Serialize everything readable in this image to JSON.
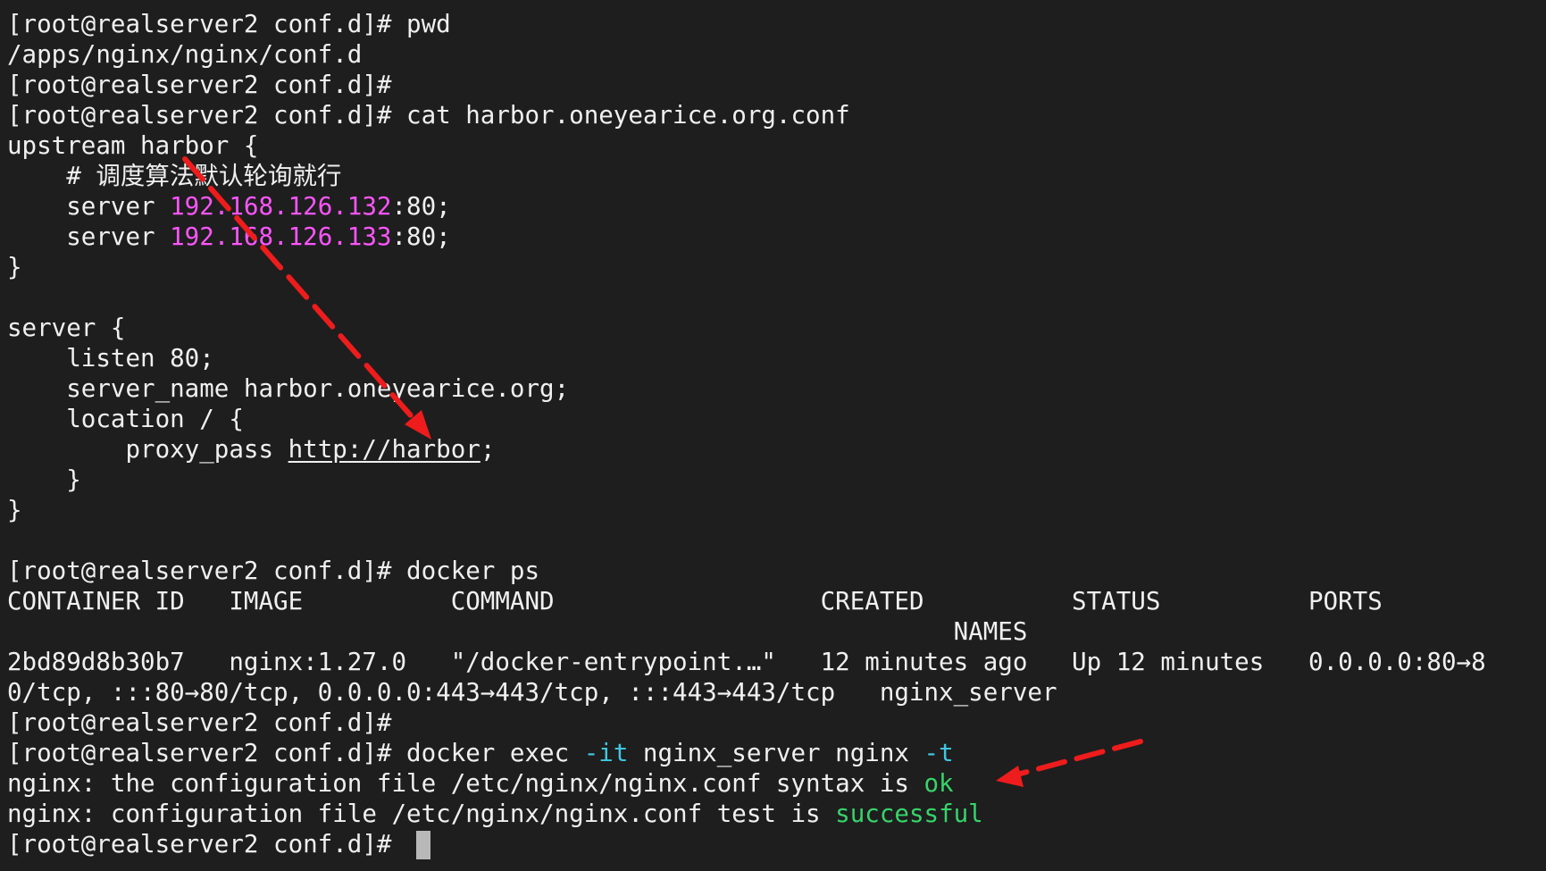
{
  "terminal": {
    "lines": [
      [
        {
          "t": "[root@realserver2 conf.d]# pwd"
        }
      ],
      [
        {
          "t": "/apps/nginx/nginx/conf.d"
        }
      ],
      [
        {
          "t": "[root@realserver2 conf.d]#"
        }
      ],
      [
        {
          "t": "[root@realserver2 conf.d]# cat harbor.oneyearice.org.conf"
        }
      ],
      [
        {
          "t": "upstream harbor {"
        }
      ],
      [
        {
          "t": "    # 调度算法默认轮询就行"
        }
      ],
      [
        {
          "t": "    server "
        },
        {
          "t": "192.168.126.132",
          "c": "ip"
        },
        {
          "t": ":80;"
        }
      ],
      [
        {
          "t": "    server "
        },
        {
          "t": "192.168.126.133",
          "c": "ip"
        },
        {
          "t": ":80;"
        }
      ],
      [
        {
          "t": "}"
        }
      ],
      [
        {
          "t": ""
        }
      ],
      [
        {
          "t": "server {"
        }
      ],
      [
        {
          "t": "    listen 80;"
        }
      ],
      [
        {
          "t": "    server_name harbor.oneyearice.org;"
        }
      ],
      [
        {
          "t": "    location / {"
        }
      ],
      [
        {
          "t": "        proxy_pass "
        },
        {
          "t": "http://harbor",
          "c": "link"
        },
        {
          "t": ";"
        }
      ],
      [
        {
          "t": "    }"
        }
      ],
      [
        {
          "t": "}"
        }
      ],
      [
        {
          "t": ""
        }
      ],
      [
        {
          "t": "[root@realserver2 conf.d]# docker ps"
        }
      ],
      [
        {
          "t": "CONTAINER ID   IMAGE          COMMAND                  CREATED          STATUS          PORTS"
        }
      ],
      [
        {
          "t": "                                                                NAMES"
        }
      ],
      [
        {
          "t": "2bd89d8b30b7   nginx:1.27.0   \"/docker-entrypoint.…\"   12 minutes ago   Up 12 minutes   0.0.0.0:80→8"
        }
      ],
      [
        {
          "t": "0/tcp, :::80→80/tcp, 0.0.0.0:443→443/tcp, :::443→443/tcp   nginx_server"
        }
      ],
      [
        {
          "t": "[root@realserver2 conf.d]#"
        }
      ],
      [
        {
          "t": "[root@realserver2 conf.d]# docker exec "
        },
        {
          "t": "-it",
          "c": "opt"
        },
        {
          "t": " nginx_server nginx "
        },
        {
          "t": "-t",
          "c": "opt"
        }
      ],
      [
        {
          "t": "nginx: the configuration file /etc/nginx/nginx.conf syntax is "
        },
        {
          "t": "ok",
          "c": "okc"
        }
      ],
      [
        {
          "t": "nginx: configuration file /etc/nginx/nginx.conf test is "
        },
        {
          "t": "successful",
          "c": "okc"
        }
      ],
      [
        {
          "t": "[root@realserver2 conf.d]# "
        }
      ]
    ]
  },
  "colors": {
    "background": "#1e1e1e",
    "foreground": "#f0f0f0",
    "ip_address": "#ff55ff",
    "command_option": "#3fc7e0",
    "success": "#36d46a",
    "annotation_arrow": "#ee1c1c",
    "cursor": "#b8b8b8"
  },
  "annotations": [
    {
      "name": "upstream-to-proxy-pass-arrow",
      "style": "dashed",
      "color": "#ee1c1c"
    },
    {
      "name": "syntax-ok-arrow",
      "style": "dashed",
      "color": "#ee1c1c"
    }
  ]
}
